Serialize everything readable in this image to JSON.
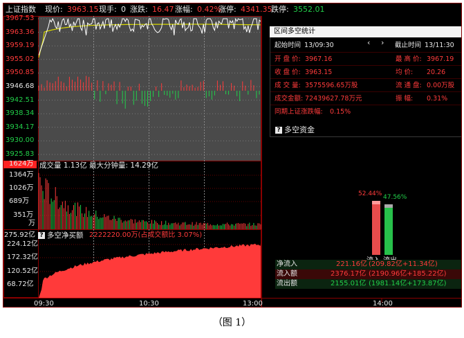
{
  "header": {
    "index_name": "上证指数",
    "price_label": "现价:",
    "price": "3963.15",
    "hand_label": "现手:",
    "hand": "0",
    "change_label": "涨跌:",
    "change": "16.47",
    "pct_label": "涨幅:",
    "pct": "0.42%",
    "limit_up_label": "涨停:",
    "limit_up": "4341.35",
    "limit_down_label": "跌停:",
    "limit_down": "3552.01"
  },
  "price_axis": [
    "3967.53",
    "3963.36",
    "3959.19",
    "3955.02",
    "3950.85",
    "3946.68",
    "3942.51",
    "3938.34",
    "3934.17",
    "3930.00",
    "3925.83"
  ],
  "volume": {
    "top_badge": "1624万",
    "label": "成交量 1.13亿  最大分钟量: 14.29亿",
    "axis": [
      "1364万",
      "1026万",
      "689万",
      "351万",
      "万"
    ]
  },
  "net": {
    "badge_left": "275.92亿",
    "icon_label": "?",
    "label": "多空净买额",
    "value_text": "2222220.00万(占成交额比 3.07%)",
    "axis": [
      "224.12亿",
      "172.32亿",
      "120.52亿",
      "68.72亿"
    ]
  },
  "time_axis": [
    "09:30",
    "10:30",
    "13:00",
    "14:00"
  ],
  "stats_panel": {
    "title": "区间多空统计",
    "start_label": "起始时间",
    "start_time": "13/09:30",
    "end_label": "截止时间",
    "end_time": "13/11:30",
    "rows": [
      {
        "left": "开 盘 价:",
        "left_val": "3967.16",
        "right": "最 高 价:",
        "right_val": "3967.19"
      },
      {
        "left": "收 盘 价:",
        "left_val": "3963.15",
        "right": "均    价:",
        "right_val": "20.26"
      },
      {
        "left": "成 交 量:",
        "left_val": "3575596.65万股",
        "right": "流 通 盘:",
        "right_val": "0.00万股"
      },
      {
        "left": "成交金额:",
        "left_val": "72439627.78万元",
        "right": "振    幅:",
        "right_val": "0.31%"
      },
      {
        "left": "同期上证涨跌幅:",
        "left_val": "0.15%",
        "right": "",
        "right_val": ""
      }
    ]
  },
  "fund": {
    "title": "多空资金",
    "inflow_pct": "52.44%",
    "outflow_pct": "47.56%",
    "inflow_label": "流入",
    "outflow_label": "流出",
    "table": [
      {
        "label": "净流入",
        "value": "221.16亿",
        "detail": "(209.82亿+11.34亿)"
      },
      {
        "label": "流入额",
        "value": "2376.17亿",
        "detail": "(2190.96亿+185.22亿)"
      },
      {
        "label": "流出额",
        "value": "2155.01亿",
        "detail": "(1981.14亿+173.87亿)"
      }
    ]
  },
  "caption": "（图 1）",
  "colors": {
    "up": "#ff3b3b",
    "down": "#22d04a",
    "avg_line": "#d8d800",
    "price_line": "#ffffff",
    "panel_bg": "#4a4a4a"
  }
}
